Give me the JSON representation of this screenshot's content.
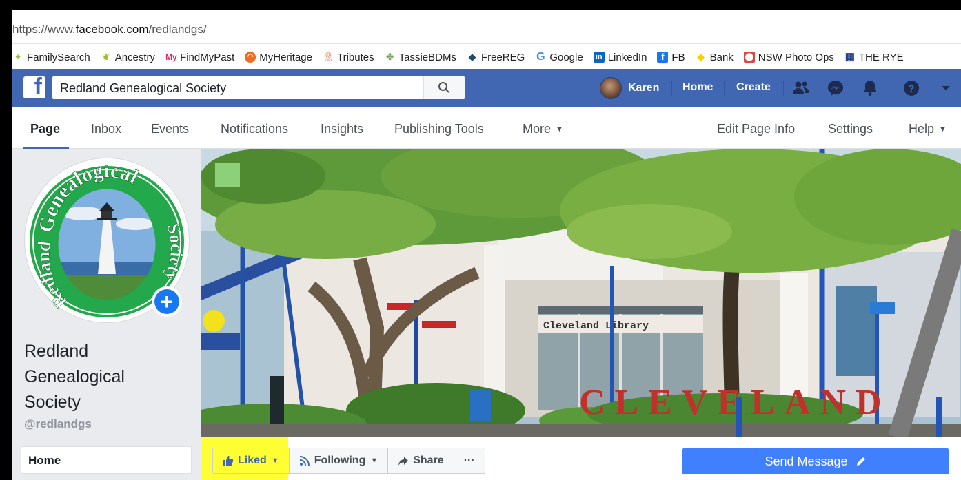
{
  "browser": {
    "url_prefix": "https://www.",
    "url_domain": "facebook.com",
    "url_path": "/redlandgs/"
  },
  "bookmarks": [
    {
      "label": "FamilySearch",
      "icon": "familysearch-icon",
      "color": "#8bbb3f"
    },
    {
      "label": "Ancestry",
      "icon": "ancestry-leaf-icon",
      "color": "#9cbe30"
    },
    {
      "label": "FindMyPast",
      "icon": "findmypast-icon",
      "color": "#e0245e"
    },
    {
      "label": "MyHeritage",
      "icon": "myheritage-icon",
      "color": "#f26b21"
    },
    {
      "label": "Tributes",
      "icon": "tributes-ribbon-icon",
      "color": "#f0a28a"
    },
    {
      "label": "TassieBDMs",
      "icon": "tassiebdms-icon",
      "color": "#7aa862"
    },
    {
      "label": "FreeREG",
      "icon": "freereg-icon",
      "color": "#1d4e6b"
    },
    {
      "label": "Google",
      "icon": "google-icon",
      "color": "#4285f4"
    },
    {
      "label": "LinkedIn",
      "icon": "linkedin-icon",
      "color": "#0a66c2"
    },
    {
      "label": "FB",
      "icon": "facebook-icon",
      "color": "#1877f2"
    },
    {
      "label": "Bank",
      "icon": "bank-diamond-icon",
      "color": "#ffcc00"
    },
    {
      "label": "NSW Photo Ops",
      "icon": "map-pin-icon",
      "color": "#e2453c"
    },
    {
      "label": "THE RYE",
      "icon": "grid-icon",
      "color": "#27418a"
    }
  ],
  "fb_header": {
    "search_value": "Redland Genealogical Society",
    "user_name": "Karen",
    "home_label": "Home",
    "create_label": "Create"
  },
  "page_nav": {
    "items": [
      "Page",
      "Inbox",
      "Events",
      "Notifications",
      "Insights",
      "Publishing Tools",
      "More"
    ],
    "right_items": [
      "Edit Page Info",
      "Settings",
      "Help"
    ]
  },
  "profile": {
    "logo_text_top": "Genealogical",
    "logo_text_left": "Redland",
    "logo_text_right": "Society",
    "name_line1": "Redland",
    "name_line2": "Genealogical",
    "name_line3": "Society",
    "handle": "@redlandgs",
    "left_home_label": "Home"
  },
  "cover": {
    "library_sign": "Cleveland Library",
    "big_letters": "CLEVELAND"
  },
  "actions": {
    "liked_label": "Liked",
    "following_label": "Following",
    "share_label": "Share",
    "more_label": "···",
    "send_message_label": "Send Message"
  },
  "colors": {
    "fb_blue": "#4267b2",
    "highlight_yellow": "#ffff33",
    "send_button": "#4080ff",
    "logo_green": "#23a84b"
  }
}
